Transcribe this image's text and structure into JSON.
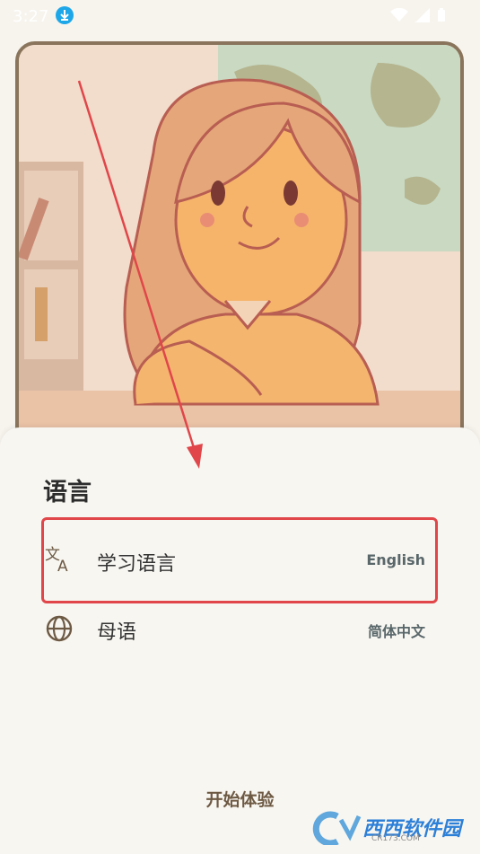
{
  "status": {
    "time": "3:27"
  },
  "sheet": {
    "title": "语言",
    "rows": [
      {
        "icon": "translate-icon",
        "label": "学习语言",
        "value": "English"
      },
      {
        "icon": "globe-icon",
        "label": "母语",
        "value": "简体中文"
      }
    ],
    "start_label": "开始体验"
  },
  "watermark": {
    "text": "西西软件园",
    "sub": "CR173.COM"
  },
  "colors": {
    "accent": "#6e5a44",
    "highlight": "#e0464a",
    "frame": "#8a755c"
  }
}
